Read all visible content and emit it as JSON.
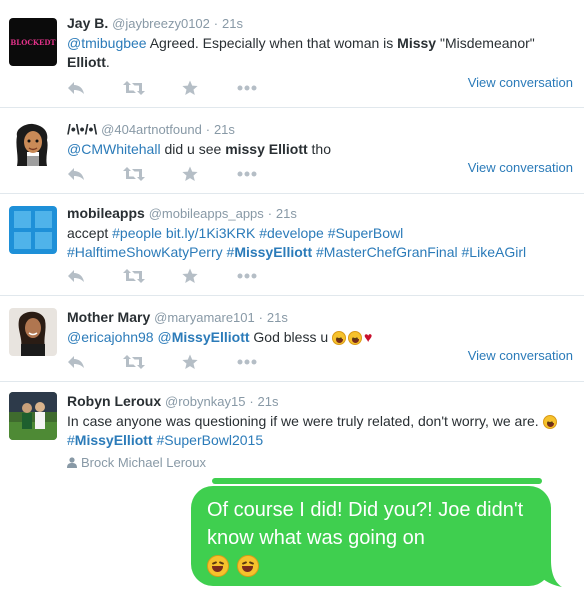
{
  "tweets": [
    {
      "fullname": "Jay B.",
      "username": "@jaybreezy0102",
      "time": "21s",
      "avatar_text": "BLOCKEDT",
      "text_parts": [
        "@tmibugbee",
        " Agreed. Especially when that woman is ",
        "Missy",
        " \"Misdemeanor\" ",
        "Elliott",
        "."
      ],
      "view_conversation": "View conversation"
    },
    {
      "fullname": "/•\\•/•\\",
      "username": "@404artnotfound",
      "time": "21s",
      "text_parts": [
        "@CMWhitehall",
        " did u see ",
        "missy Elliott",
        " tho"
      ],
      "view_conversation": "View conversation"
    },
    {
      "fullname": "mobileapps",
      "username": "@mobileapps_apps",
      "time": "21s",
      "text_parts": [
        "accept ",
        "#people",
        " ",
        "bit.ly/1Ki3KRK",
        " ",
        "#develope",
        "  ",
        "#SuperBowl",
        "#HalftimeShowKatyPerry",
        " ",
        "#",
        "MissyElliott",
        " ",
        "#MasterChefGranFinal",
        " ",
        "#LikeAGirl"
      ]
    },
    {
      "fullname": "Mother Mary",
      "username": "@maryamare101",
      "time": "21s",
      "text_parts": [
        "@ericajohn98",
        " ",
        "@",
        "MissyElliott",
        " God bless u "
      ],
      "view_conversation": "View conversation"
    },
    {
      "fullname": "Robyn Leroux",
      "username": "@robynkay15",
      "time": "21s",
      "text_parts": [
        "In case anyone was questioning if we were truly related, don't worry, we are. ",
        "#",
        "MissyElliott",
        " ",
        "#SuperBowl2015"
      ],
      "mention": "Brock Michael Leroux"
    }
  ],
  "imessage": {
    "text": "Of course I did! Did you?! Joe didn't know what was going on"
  },
  "colors": {
    "link": "#2b7bb9",
    "bubble": "#3fcf4f",
    "meta": "#8899a6",
    "action_icon": "#b5bec6"
  },
  "icons": [
    "reply-icon",
    "retweet-icon",
    "favorite-icon",
    "more-icon",
    "person-icon",
    "crying-laughing-emoji",
    "heart-emoji"
  ]
}
